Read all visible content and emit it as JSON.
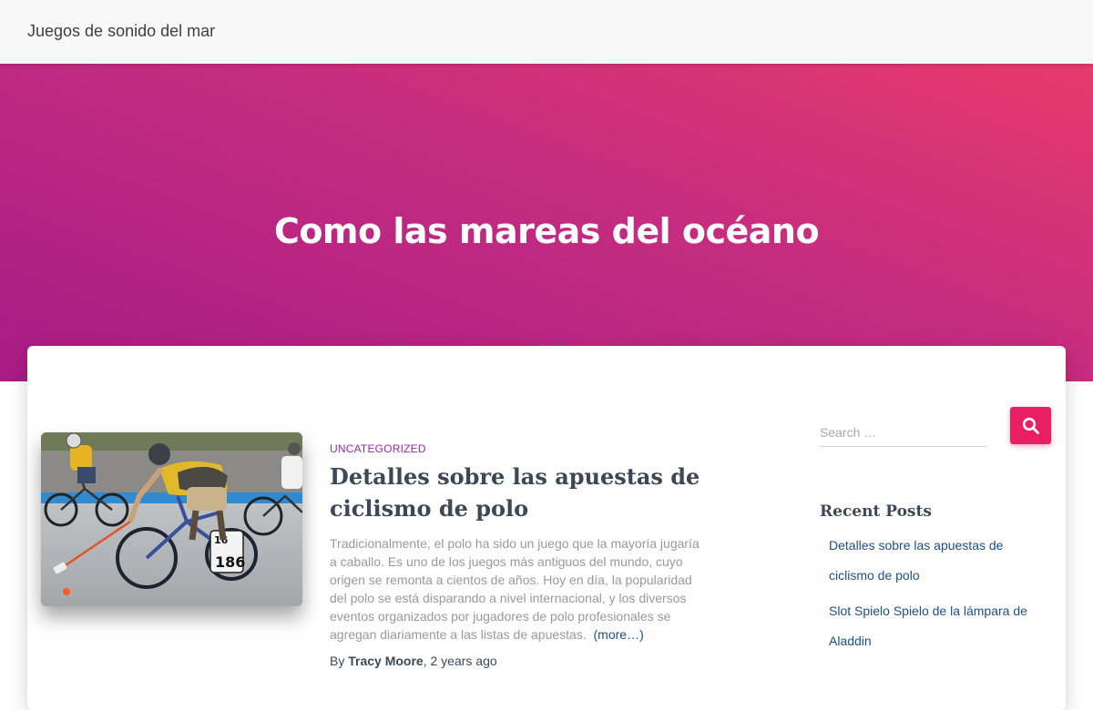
{
  "site": {
    "brand": "Juegos de sonido del mar"
  },
  "hero": {
    "title": "Como las mareas del océano"
  },
  "post": {
    "category": "UNCATEGORIZED",
    "title": "Detalles sobre las apuestas de ciclismo de polo",
    "excerpt": "Tradicionalmente, el polo ha sido un juego que la mayoría jugaría a caballo. Es uno de los juegos más antiguos del mundo, cuyo origen se remonta a cientos de años. Hoy en día, la popularidad del polo se está disparando a nivel internacional, y los diversos eventos organizados por jugadores de polo profesionales se agregan diariamente a las listas de apuestas.",
    "more_label": "(more…)",
    "by_label": "By",
    "author": "Tracy Moore",
    "date": "2 years ago",
    "image_numbers": [
      "16",
      "186"
    ]
  },
  "sidebar": {
    "search_placeholder": "Search …",
    "search_icon": "search-icon",
    "recent_title": "Recent Posts",
    "recent_posts": [
      "Detalles sobre las apuestas de ciclismo de polo",
      "Slot Spielo Spielo de la lámpara de Aladdin"
    ]
  },
  "colors": {
    "accent": "#e91e63",
    "category": "#9c27b0",
    "link": "#1e4f8f",
    "hero_gradient_start": "#e73a6c",
    "hero_gradient_end": "#a81c85",
    "heading": "#3c4858"
  }
}
